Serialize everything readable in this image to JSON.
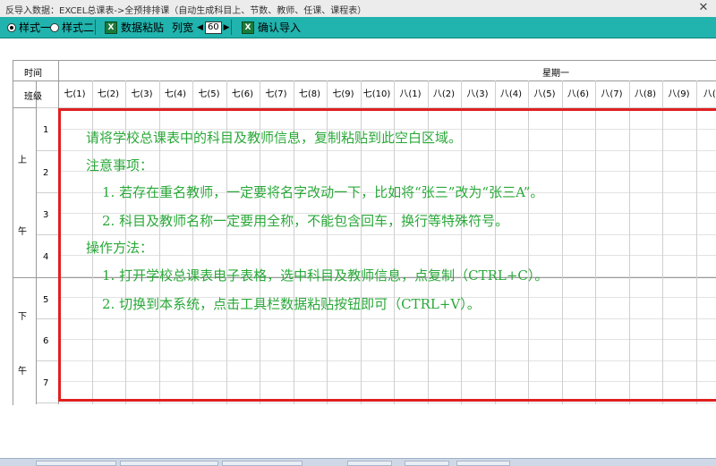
{
  "window": {
    "title": "反导入数据：EXCEL总课表->全预排排课（自动生成科目上、节数、教师、任课、课程表）",
    "close_glyph": "✕"
  },
  "toolbar": {
    "style1": "样式一",
    "style2": "样式二",
    "paste_label": "数据粘贴",
    "colwidth_label": "列宽",
    "colwidth_value": "60",
    "confirm_label": "确认导入",
    "icon_glyph": "X"
  },
  "grid": {
    "time_header": "时间",
    "day_header": "星期一",
    "class_header": "班级",
    "columns": [
      "七(1)",
      "七(2)",
      "七(3)",
      "七(4)",
      "七(5)",
      "七(6)",
      "七(7)",
      "七(8)",
      "七(9)",
      "七(10)",
      "八(1)",
      "八(2)",
      "八(3)",
      "八(4)",
      "八(5)",
      "八(6)",
      "八(7)",
      "八(8)",
      "八(9)",
      "八(1"
    ],
    "period_numbers": [
      "1",
      "2",
      "3",
      "4",
      "5",
      "6",
      "7"
    ],
    "morning": [
      "上",
      "午"
    ],
    "afternoon": [
      "下",
      "午"
    ]
  },
  "instructions": {
    "line1": "请将学校总课表中的科目及教师信息，复制粘贴到此空白区域。",
    "line2": "注意事项：",
    "line3": "1. 若存在重名教师，一定要将名字改动一下，比如将“张三”改为“张三A”。",
    "line4": "2. 科目及教师名称一定要用全称，不能包含回车，换行等特殊符号。",
    "line5": "操作方法：",
    "line6": "1. 打开学校总课表电子表格，选中科目及教师信息，点复制（CTRL+C）。",
    "line7": "2. 切换到本系统，点击工具栏数据粘贴按钮即可（CTRL+V）。"
  }
}
